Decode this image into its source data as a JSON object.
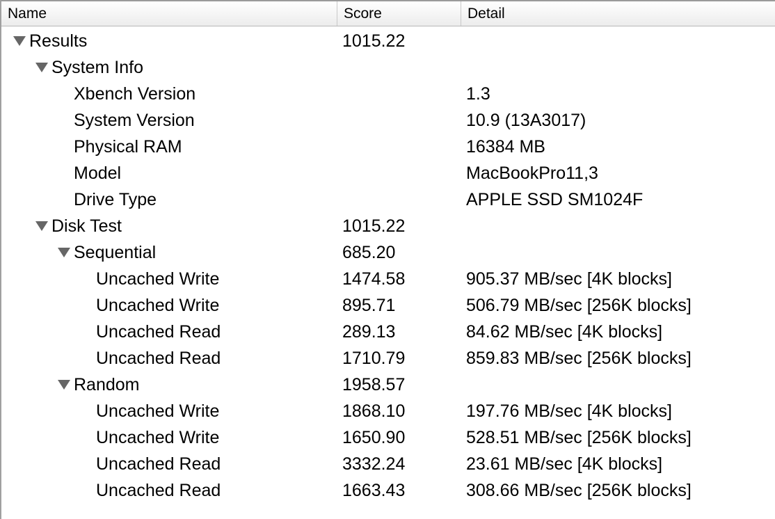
{
  "columns": {
    "name": "Name",
    "score": "Score",
    "detail": "Detail"
  },
  "rows": [
    {
      "name": "Results",
      "score": "1015.22",
      "detail": ""
    },
    {
      "name": "System Info",
      "score": "",
      "detail": ""
    },
    {
      "name": "Xbench Version",
      "score": "",
      "detail": "1.3"
    },
    {
      "name": "System Version",
      "score": "",
      "detail": "10.9 (13A3017)"
    },
    {
      "name": "Physical RAM",
      "score": "",
      "detail": "16384 MB"
    },
    {
      "name": "Model",
      "score": "",
      "detail": "MacBookPro11,3"
    },
    {
      "name": "Drive Type",
      "score": "",
      "detail": "APPLE SSD SM1024F"
    },
    {
      "name": "Disk Test",
      "score": "1015.22",
      "detail": ""
    },
    {
      "name": "Sequential",
      "score": "685.20",
      "detail": ""
    },
    {
      "name": "Uncached Write",
      "score": "1474.58",
      "detail": "905.37 MB/sec [4K blocks]"
    },
    {
      "name": "Uncached Write",
      "score": "895.71",
      "detail": "506.79 MB/sec [256K blocks]"
    },
    {
      "name": "Uncached Read",
      "score": "289.13",
      "detail": "84.62 MB/sec [4K blocks]"
    },
    {
      "name": "Uncached Read",
      "score": "1710.79",
      "detail": "859.83 MB/sec [256K blocks]"
    },
    {
      "name": "Random",
      "score": "1958.57",
      "detail": ""
    },
    {
      "name": "Uncached Write",
      "score": "1868.10",
      "detail": "197.76 MB/sec [4K blocks]"
    },
    {
      "name": "Uncached Write",
      "score": "1650.90",
      "detail": "528.51 MB/sec [256K blocks]"
    },
    {
      "name": "Uncached Read",
      "score": "3332.24",
      "detail": "23.61 MB/sec [4K blocks]"
    },
    {
      "name": "Uncached Read",
      "score": "1663.43",
      "detail": "308.66 MB/sec [256K blocks]"
    }
  ]
}
